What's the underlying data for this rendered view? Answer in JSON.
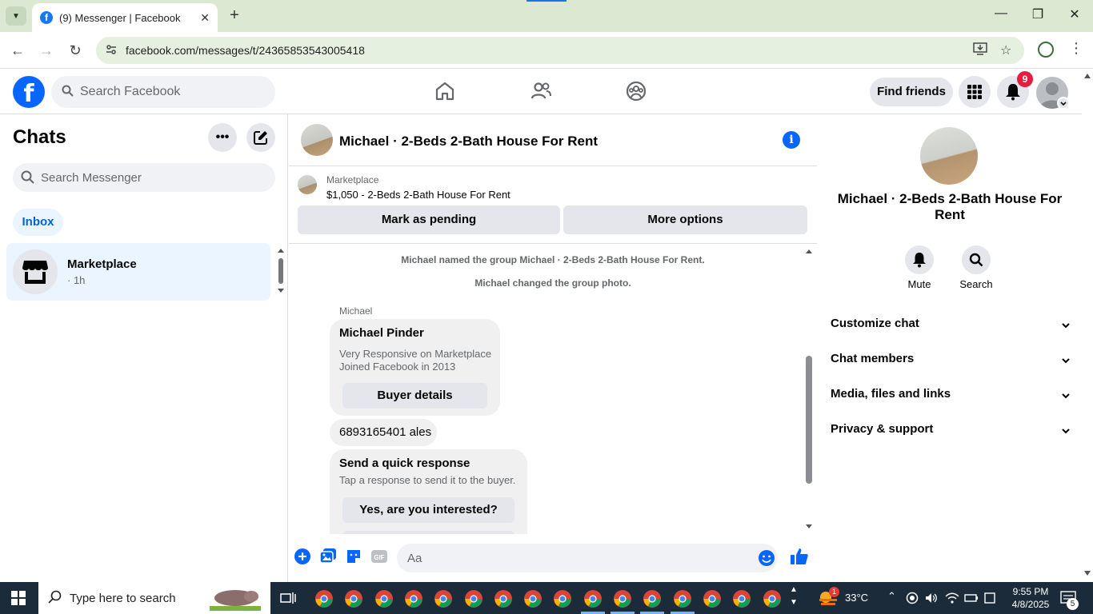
{
  "browser": {
    "tab_title": "(9) Messenger | Facebook",
    "tab_favicon": "f",
    "url": "facebook.com/messages/t/24365853543005418",
    "close_glyph": "✕",
    "new_tab_glyph": "+",
    "minimize_glyph": "—",
    "maximize_glyph": "❐",
    "window_close_glyph": "✕",
    "back_glyph": "←",
    "forward_glyph": "→",
    "reload_glyph": "↻",
    "menu_glyph": "⋮"
  },
  "fb_header": {
    "logo": "f",
    "search_placeholder": "Search Facebook",
    "find_friends_label": "Find friends",
    "notification_count": "9"
  },
  "left": {
    "title": "Chats",
    "more_glyph": "•••",
    "search_placeholder": "Search Messenger",
    "inbox_label": "Inbox",
    "chats": [
      {
        "name": "Marketplace",
        "time": "· 1h"
      }
    ]
  },
  "conversation": {
    "title": "Michael · 2-Beds 2-Bath House For Rent",
    "info_glyph": "i",
    "marketplace_label": "Marketplace",
    "listing": "$1,050 - 2-Beds 2-Bath House For Rent",
    "mark_pending_label": "Mark as pending",
    "more_options_label": "More options",
    "system_messages": [
      "Michael named the group Michael · 2-Beds 2-Bath House For Rent.",
      "Michael changed the group photo."
    ],
    "sender": "Michael",
    "card": {
      "name": "Michael Pinder",
      "line1": "Very Responsive on Marketplace",
      "line2": "Joined Facebook in 2013",
      "button": "Buyer details"
    },
    "message": "6893165401 ales",
    "quick": {
      "title": "Send a quick response",
      "subtitle": "Tap a response to send it to the buyer.",
      "option1": "Yes, are you interested?"
    },
    "composer_placeholder": "Aa"
  },
  "right": {
    "name": "Michael · 2-Beds 2-Bath House For Rent",
    "mute_label": "Mute",
    "search_label": "Search",
    "sections": [
      "Customize chat",
      "Chat members",
      "Media, files and links",
      "Privacy & support"
    ]
  },
  "taskbar": {
    "search_text": "Type here to search",
    "weather": "33°C",
    "weather_badge": "1",
    "time": "9:55 PM",
    "date": "4/8/2025",
    "notif_count": "5"
  },
  "colors": {
    "fb_blue": "#0866ff",
    "badge_red": "#e41e3f",
    "chrome_green": "#dbe9d3",
    "taskbar": "#1c2b3a"
  }
}
